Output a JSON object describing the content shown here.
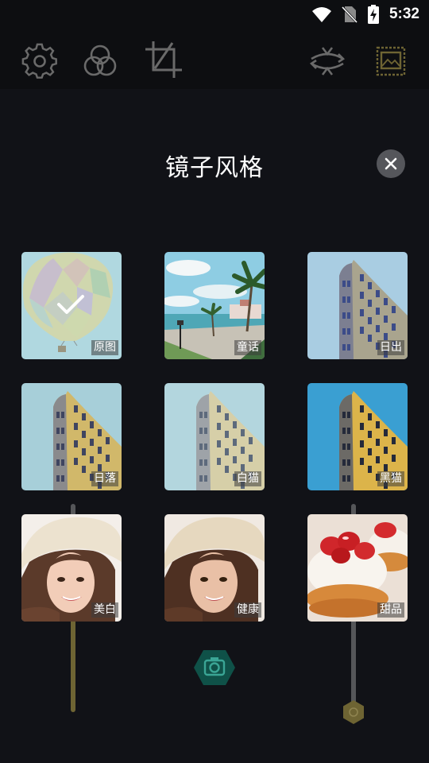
{
  "status_bar": {
    "time": "5:32"
  },
  "toolbar": {
    "icons": [
      "gear-icon",
      "filter-circles-icon",
      "crop-icon",
      "flip-camera-icon",
      "stamp-frame-icon"
    ]
  },
  "dialog": {
    "title": "镜子风格",
    "filters": [
      {
        "label": "原图",
        "selected": true
      },
      {
        "label": "童话",
        "selected": false
      },
      {
        "label": "日出",
        "selected": false
      },
      {
        "label": "日落",
        "selected": false
      },
      {
        "label": "白猫",
        "selected": false
      },
      {
        "label": "黑猫",
        "selected": false
      },
      {
        "label": "美白",
        "selected": false
      },
      {
        "label": "健康",
        "selected": false
      },
      {
        "label": "甜品",
        "selected": false
      }
    ]
  },
  "colors": {
    "background": "#111217",
    "slider_left": "#6e6433",
    "slider_right": "#555659",
    "shutter": "#0f5148",
    "knob": "#6e6433"
  }
}
